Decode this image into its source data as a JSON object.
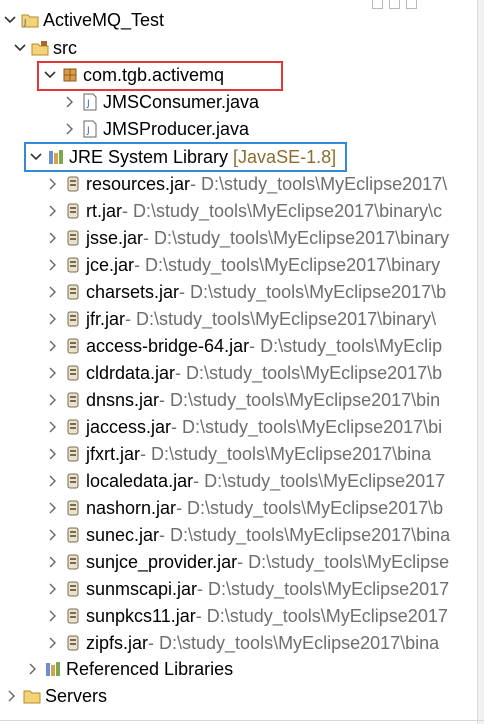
{
  "tree": {
    "project": {
      "label": "ActiveMQ_Test",
      "icon": "java-project-icon"
    },
    "src": {
      "label": "src",
      "icon": "source-folder-icon"
    },
    "package": {
      "label": "com.tgb.activemq",
      "icon": "package-icon"
    },
    "files": [
      {
        "label": "JMSConsumer.java",
        "icon": "java-file-icon"
      },
      {
        "label": "JMSProducer.java",
        "icon": "java-file-icon"
      }
    ],
    "jre": {
      "label": "JRE System Library",
      "decoration": "[JavaSE-1.8]",
      "icon": "library-icon"
    },
    "jars": [
      {
        "label": "resources.jar",
        "path": " - D:\\study_tools\\MyEclipse2017\\"
      },
      {
        "label": "rt.jar",
        "path": " - D:\\study_tools\\MyEclipse2017\\binary\\c"
      },
      {
        "label": "jsse.jar",
        "path": " - D:\\study_tools\\MyEclipse2017\\binary"
      },
      {
        "label": "jce.jar",
        "path": " - D:\\study_tools\\MyEclipse2017\\binary"
      },
      {
        "label": "charsets.jar",
        "path": " - D:\\study_tools\\MyEclipse2017\\b"
      },
      {
        "label": "jfr.jar",
        "path": " - D:\\study_tools\\MyEclipse2017\\binary\\"
      },
      {
        "label": "access-bridge-64.jar",
        "path": " - D:\\study_tools\\MyEclip"
      },
      {
        "label": "cldrdata.jar",
        "path": " - D:\\study_tools\\MyEclipse2017\\b"
      },
      {
        "label": "dnsns.jar",
        "path": " - D:\\study_tools\\MyEclipse2017\\bin"
      },
      {
        "label": "jaccess.jar",
        "path": " - D:\\study_tools\\MyEclipse2017\\bi"
      },
      {
        "label": "jfxrt.jar",
        "path": " - D:\\study_tools\\MyEclipse2017\\bina"
      },
      {
        "label": "localedata.jar",
        "path": " - D:\\study_tools\\MyEclipse2017"
      },
      {
        "label": "nashorn.jar",
        "path": " - D:\\study_tools\\MyEclipse2017\\b"
      },
      {
        "label": "sunec.jar",
        "path": " - D:\\study_tools\\MyEclipse2017\\bina"
      },
      {
        "label": "sunjce_provider.jar",
        "path": " - D:\\study_tools\\MyEclipse"
      },
      {
        "label": "sunmscapi.jar",
        "path": " - D:\\study_tools\\MyEclipse2017"
      },
      {
        "label": "sunpkcs11.jar",
        "path": " - D:\\study_tools\\MyEclipse2017"
      },
      {
        "label": "zipfs.jar",
        "path": " - D:\\study_tools\\MyEclipse2017\\bina"
      }
    ],
    "referenced": {
      "label": "Referenced Libraries",
      "icon": "referenced-libraries-icon"
    },
    "servers": {
      "label": "Servers",
      "icon": "folder-icon"
    }
  },
  "colors": {
    "highlight_red": "#e03838",
    "highlight_blue": "#2f8bd8",
    "path_gray": "#6e6e6e",
    "decoration": "#8a6d2f"
  }
}
